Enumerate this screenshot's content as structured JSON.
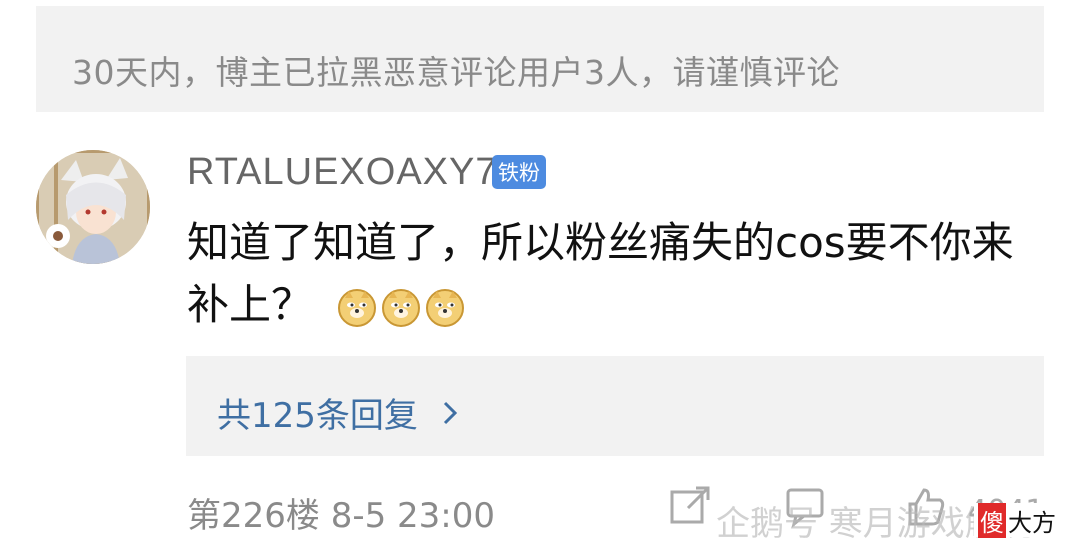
{
  "notice": {
    "text": "30天内，博主已拉黑恶意评论用户3人，请谨慎评论"
  },
  "comment": {
    "username": "RTALUEXOAXY7",
    "badge": "铁粉",
    "text": "知道了知道了，所以粉丝痛失的cos要不你来补上？",
    "emojis": [
      "doge-emoji",
      "doge-emoji",
      "doge-emoji"
    ],
    "replies_label": "共125条回复",
    "floor_time": "第226楼 8-5 23:00",
    "likes": "4041"
  },
  "watermark": {
    "text": "企鹅号 寒月游戏解说",
    "brand_square": "傻",
    "brand_rest": "大方"
  },
  "colors": {
    "badge": "#4d8be0",
    "replies_link": "#3f6fa3",
    "notice_bg": "#f2f2f2"
  }
}
